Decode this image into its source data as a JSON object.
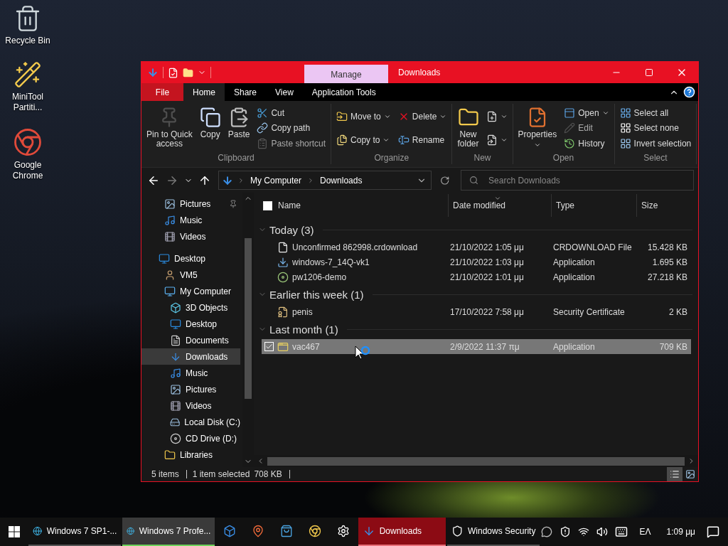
{
  "desktop_icons": [
    {
      "label": "Recycle Bin"
    },
    {
      "label": "MiniTool Partiti..."
    },
    {
      "label": "Google Chrome"
    }
  ],
  "window": {
    "title": "Downloads",
    "context_tab": "Manage",
    "ribbon_tabs": [
      {
        "label": "File",
        "kind": "file",
        "selected": false
      },
      {
        "label": "Home",
        "kind": "tab",
        "selected": true
      },
      {
        "label": "Share",
        "kind": "tab",
        "selected": false
      },
      {
        "label": "View",
        "kind": "tab",
        "selected": false
      },
      {
        "label": "Application Tools",
        "kind": "tab",
        "selected": false
      }
    ],
    "ribbon_groups": [
      {
        "label": "Clipboard",
        "columns": [
          {
            "kind": "large",
            "buttons": [
              {
                "label": "Pin to Quick\naccess",
                "dropdown": false,
                "disabled": true
              }
            ]
          },
          {
            "kind": "large",
            "buttons": [
              {
                "label": "Copy",
                "dropdown": false,
                "disabled": false
              }
            ]
          },
          {
            "kind": "large",
            "buttons": [
              {
                "label": "Paste",
                "dropdown": false,
                "disabled": false
              }
            ]
          },
          {
            "kind": "small",
            "buttons": [
              {
                "label": "Cut",
                "dropdown": false,
                "disabled": false
              },
              {
                "label": "Copy path",
                "dropdown": false,
                "disabled": false
              },
              {
                "label": "Paste shortcut",
                "dropdown": false,
                "disabled": true
              }
            ]
          }
        ]
      },
      {
        "label": "Organize",
        "columns": [
          {
            "kind": "small",
            "buttons": [
              {
                "label": "Move to",
                "dropdown": true,
                "disabled": false
              },
              {
                "label": "Copy to",
                "dropdown": true,
                "disabled": false
              }
            ]
          },
          {
            "kind": "small",
            "buttons": [
              {
                "label": "Delete",
                "dropdown": true,
                "disabled": false
              },
              {
                "label": "Rename",
                "dropdown": false,
                "disabled": false
              }
            ]
          }
        ]
      },
      {
        "label": "New",
        "columns": [
          {
            "kind": "large",
            "buttons": [
              {
                "label": "New\nfolder",
                "dropdown": false,
                "disabled": false
              }
            ]
          },
          {
            "kind": "small",
            "buttons": [
              {
                "dropdown": true,
                "disabled": false
              },
              {
                "dropdown": true,
                "disabled": false
              }
            ]
          }
        ]
      },
      {
        "label": "Open",
        "columns": [
          {
            "kind": "large",
            "buttons": [
              {
                "label": "Properties",
                "dropdown": true,
                "disabled": false
              }
            ]
          },
          {
            "kind": "small",
            "buttons": [
              {
                "label": "Open",
                "dropdown": true,
                "disabled": false
              },
              {
                "label": "Edit",
                "dropdown": false,
                "disabled": true
              },
              {
                "label": "History",
                "dropdown": false,
                "disabled": false
              }
            ]
          }
        ]
      },
      {
        "label": "Select",
        "columns": [
          {
            "kind": "small",
            "buttons": [
              {
                "label": "Select all",
                "dropdown": false,
                "disabled": false
              },
              {
                "label": "Select none",
                "dropdown": false,
                "disabled": false
              },
              {
                "label": "Invert selection",
                "dropdown": false,
                "disabled": false
              }
            ]
          }
        ]
      }
    ],
    "nav_buttons": [
      {
        "kind": "back",
        "disabled": false
      },
      {
        "kind": "forward",
        "disabled": true
      },
      {
        "kind": "recent",
        "disabled": false
      },
      {
        "kind": "up",
        "disabled": false
      }
    ],
    "breadcrumbs": [
      "My Computer",
      "Downloads"
    ],
    "search": {
      "placeholder": "Search Downloads"
    },
    "quick_access": [
      {
        "label": "Pictures",
        "pinned": true,
        "selected": false
      },
      {
        "label": "Music",
        "pinned": false,
        "selected": false
      },
      {
        "label": "Videos",
        "pinned": false,
        "selected": false
      }
    ],
    "tree": [
      {
        "label": "Desktop",
        "selected": false,
        "children": [
          {
            "label": "VM5",
            "selected": false
          },
          {
            "label": "My Computer",
            "selected": false,
            "children": [
              {
                "label": "3D Objects",
                "selected": false
              },
              {
                "label": "Desktop",
                "selected": false
              },
              {
                "label": "Documents",
                "selected": false
              },
              {
                "label": "Downloads",
                "selected": true
              },
              {
                "label": "Music",
                "selected": false
              },
              {
                "label": "Pictures",
                "selected": false
              },
              {
                "label": "Videos",
                "selected": false
              },
              {
                "label": "Local Disk (C:)",
                "selected": false
              },
              {
                "label": "CD Drive (D:)",
                "selected": false
              }
            ]
          },
          {
            "label": "Libraries",
            "selected": false
          }
        ]
      }
    ],
    "table": {
      "select_all_checked": false,
      "columns": [
        {
          "label": "Name",
          "sorted": false
        },
        {
          "label": "Date modified",
          "sorted": true
        },
        {
          "label": "Type",
          "sorted": false
        },
        {
          "label": "Size",
          "sorted": false
        }
      ],
      "groups": [
        {
          "label": "Today (3)",
          "expanded": true,
          "rows": [
            {
              "name": "Unconfirmed 862998.crdownload",
              "date": "21/10/2022 1:05 μμ",
              "type": "CRDOWNLOAD File",
              "size": "15.428 KB",
              "selected": false
            },
            {
              "name": "windows-7_14Q-vk1",
              "date": "21/10/2022 1:03 μμ",
              "type": "Application",
              "size": "1.695 KB",
              "selected": false
            },
            {
              "name": "pw1206-demo",
              "date": "21/10/2022 1:01 μμ",
              "type": "Application",
              "size": "27.218 KB",
              "selected": false
            }
          ]
        },
        {
          "label": "Earlier this week (1)",
          "expanded": true,
          "rows": [
            {
              "name": "penis",
              "date": "17/10/2022 7:58 μμ",
              "type": "Security Certificate",
              "size": "2 KB",
              "selected": false
            }
          ]
        },
        {
          "label": "Last month (1)",
          "expanded": true,
          "rows": [
            {
              "name": "vac467",
              "date": "2/9/2022 11:37 πμ",
              "type": "Application",
              "size": "709 KB",
              "selected": true
            }
          ]
        }
      ]
    },
    "status_bar": {
      "item_count": "5 items",
      "selection": "1 item selected",
      "selection_size": "708 KB",
      "views": [
        {
          "kind": "details",
          "selected": true
        },
        {
          "kind": "large_icons",
          "selected": false
        }
      ]
    }
  },
  "taskbar": {
    "items": [
      {
        "kind": "edge",
        "label": "Windows 7 SP1-...",
        "selected": false,
        "highlighted": false,
        "running": true
      },
      {
        "kind": "edge",
        "label": "Windows 7 Profe...",
        "selected": false,
        "highlighted": true,
        "running": true
      },
      {
        "kind": "app",
        "selected": false,
        "highlighted": false,
        "running": false
      },
      {
        "kind": "maps",
        "selected": false,
        "highlighted": false,
        "running": false
      },
      {
        "kind": "store",
        "selected": false,
        "highlighted": false,
        "running": false
      },
      {
        "kind": "chrome",
        "selected": false,
        "highlighted": false,
        "running": false
      },
      {
        "kind": "settings",
        "selected": false,
        "highlighted": false,
        "running": false
      },
      {
        "kind": "explorer",
        "label": "Downloads",
        "selected": true,
        "highlighted": false,
        "running": true
      },
      {
        "kind": "security",
        "label": "Windows Security",
        "selected": false,
        "highlighted": false,
        "running": true
      }
    ],
    "language": "ΕΛ",
    "time": "1:09 μμ"
  }
}
